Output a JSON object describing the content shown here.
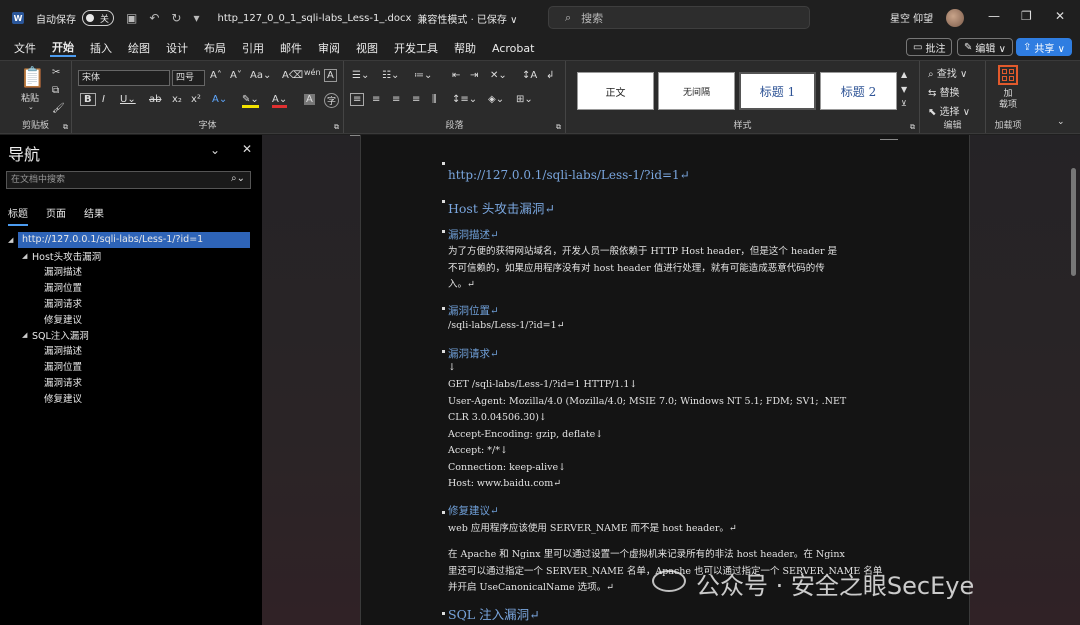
{
  "titlebar": {
    "app_icon": "W",
    "autosave_label": "自动保存",
    "autosave_state": "关",
    "filename": "http_127_0_0_1_sqli-labs_Less-1_.docx",
    "mode": "兼容性模式 · 已保存 ∨",
    "search_placeholder": "搜索",
    "user": "星空 仰望"
  },
  "menu": {
    "items": [
      "文件",
      "开始",
      "插入",
      "绘图",
      "设计",
      "布局",
      "引用",
      "邮件",
      "审阅",
      "视图",
      "开发工具",
      "帮助",
      "Acrobat"
    ],
    "active": "开始",
    "comment_label": "批注",
    "edit_label": "编辑 ∨",
    "share_label": "共享 ∨"
  },
  "ribbon": {
    "clipboard_label": "剪贴板",
    "paste_label": "粘贴",
    "font_label": "字体",
    "font_name": "宋体",
    "font_size": "四号",
    "paragraph_label": "段落",
    "styles_label": "样式",
    "styles": [
      "正文",
      "无间隔",
      "标题 1",
      "标题 2"
    ],
    "editing_label": "编辑",
    "find_label": "查找 ∨",
    "replace_label": "替换",
    "select_label": "选择 ∨",
    "addins_label": "加载项",
    "addins_button": "加\n载项"
  },
  "nav": {
    "title": "导航",
    "search_placeholder": "在文档中搜索",
    "tabs": [
      "标题",
      "页面",
      "结果"
    ],
    "tree": [
      {
        "label": "http://127.0.0.1/sqli-labs/Less-1/?id=1",
        "level": 0,
        "expanded": true,
        "selected": true
      },
      {
        "label": "Host头攻击漏洞",
        "level": 1,
        "expanded": true
      },
      {
        "label": "漏洞描述",
        "level": 2
      },
      {
        "label": "漏洞位置",
        "level": 2
      },
      {
        "label": "漏洞请求",
        "level": 2
      },
      {
        "label": "修复建议",
        "level": 2
      },
      {
        "label": "SQL注入漏洞",
        "level": 1,
        "expanded": true
      },
      {
        "label": "漏洞描述",
        "level": 2
      },
      {
        "label": "漏洞位置",
        "level": 2
      },
      {
        "label": "漏洞请求",
        "level": 2
      },
      {
        "label": "修复建议",
        "level": 2
      }
    ]
  },
  "doc": {
    "url_title": "http://127.0.0.1/sqli-labs/Less-1/?id=1↵",
    "host_heading": "Host 头攻击漏洞↵",
    "desc_heading": "漏洞描述↵",
    "desc_line1": "为了方便的获得网站域名，开发人员一般依赖于 HTTP Host header，但是这个 header 是",
    "desc_line2": "不可信赖的，如果应用程序没有对 host header 值进行处理，就有可能造成恶意代码的传",
    "desc_line3": "入。↵",
    "loc_heading": "漏洞位置↵",
    "loc_text": "/sqli-labs/Less-1/?id=1↵",
    "req_heading": "漏洞请求↵",
    "req_blank": "↓",
    "req_lines": [
      "GET /sqli-labs/Less-1/?id=1 HTTP/1.1↓",
      "User-Agent: Mozilla/4.0 (Mozilla/4.0; MSIE 7.0; Windows NT 5.1; FDM; SV1; .NET",
      "CLR 3.0.04506.30)↓",
      "Accept-Encoding: gzip, deflate↓",
      "Accept: */*↓",
      "Connection: keep-alive↓",
      "Host: www.baidu.com↵"
    ],
    "fix_heading": "修复建议↵",
    "fix_line1": "web 应用程序应该使用 SERVER_NAME 而不是 host header。↵",
    "fix_line2": "在 Apache 和 Nginx 里可以通过设置一个虚拟机来记录所有的非法 host header。在 Nginx",
    "fix_line3": "里还可以通过指定一个 SERVER_NAME 名单，Apache 也可以通过指定一个 SERVER_NAME 名单",
    "fix_line4": "并开启 UseCanonicalName 选项。↵",
    "sql_heading": "SQL 注入漏洞↵"
  },
  "watermark": "公众号 · 安全之眼SecEye"
}
